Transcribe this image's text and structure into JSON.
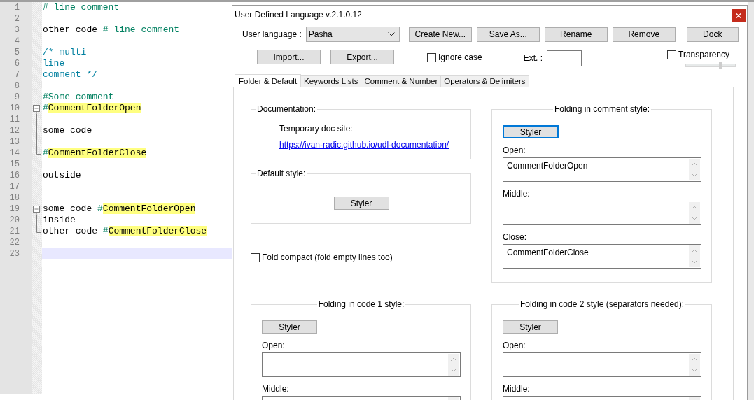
{
  "editor": {
    "lines": [
      {
        "number": "1",
        "kind": "plain",
        "segments": [
          {
            "text": "# line comment",
            "kind": "comment"
          }
        ]
      },
      {
        "number": "2",
        "kind": "plain"
      },
      {
        "number": "3",
        "kind": "plain",
        "segments": [
          {
            "text": "other code ",
            "kind": "code"
          },
          {
            "text": "# line comment",
            "kind": "comment"
          }
        ]
      },
      {
        "number": "4",
        "kind": "plain"
      },
      {
        "number": "5",
        "kind": "plain",
        "segments": [
          {
            "text": "/* multi",
            "kind": "block"
          }
        ]
      },
      {
        "number": "6",
        "kind": "plain",
        "segments": [
          {
            "text": "line",
            "kind": "block"
          }
        ]
      },
      {
        "number": "7",
        "kind": "plain",
        "segments": [
          {
            "text": "comment */",
            "kind": "block"
          }
        ]
      },
      {
        "number": "8",
        "kind": "plain"
      },
      {
        "number": "9",
        "kind": "plain",
        "segments": [
          {
            "text": "#Some comment",
            "kind": "comment"
          }
        ]
      },
      {
        "number": "10",
        "kind": "fold_open",
        "segments": [
          {
            "text": "#",
            "kind": "comment"
          },
          {
            "text": "CommentFolderOpen",
            "kind": "keyword"
          }
        ]
      },
      {
        "number": "11",
        "kind": "fold_middle"
      },
      {
        "number": "12",
        "kind": "fold_middle",
        "segments": [
          {
            "text": "some code",
            "kind": "code"
          }
        ]
      },
      {
        "number": "13",
        "kind": "fold_middle"
      },
      {
        "number": "14",
        "kind": "fold_end",
        "segments": [
          {
            "text": "#",
            "kind": "comment"
          },
          {
            "text": "CommentFolderClose",
            "kind": "keyword"
          }
        ]
      },
      {
        "number": "15",
        "kind": "plain"
      },
      {
        "number": "16",
        "kind": "plain",
        "segments": [
          {
            "text": "outside",
            "kind": "code"
          }
        ]
      },
      {
        "number": "17",
        "kind": "plain"
      },
      {
        "number": "18",
        "kind": "plain"
      },
      {
        "number": "19",
        "kind": "fold_open",
        "segments": [
          {
            "text": "some code ",
            "kind": "code"
          },
          {
            "text": "#",
            "kind": "comment"
          },
          {
            "text": "CommentFolderOpen",
            "kind": "keyword"
          }
        ]
      },
      {
        "number": "20",
        "kind": "fold_middle",
        "segments": [
          {
            "text": "inside",
            "kind": "code"
          }
        ]
      },
      {
        "number": "21",
        "kind": "fold_end",
        "segments": [
          {
            "text": "other code ",
            "kind": "code"
          },
          {
            "text": "#",
            "kind": "comment"
          },
          {
            "text": "CommentFolderClose",
            "kind": "keyword"
          }
        ]
      },
      {
        "number": "22",
        "kind": "plain"
      },
      {
        "number": "23",
        "kind": "plain",
        "current": true
      }
    ]
  },
  "dialog": {
    "title": "User Defined Language v.2.1.0.12",
    "language_label": "User language :",
    "language_value": "Pasha",
    "top_buttons": [
      "Create New...",
      "Save As...",
      "Rename",
      "Remove"
    ],
    "dock_button": "Dock",
    "io_buttons": [
      "Import...",
      "Export..."
    ],
    "ignore_case": {
      "label": "Ignore case",
      "checked": false
    },
    "ext_label": "Ext. :",
    "transparency": {
      "label": "Transparency",
      "checked": false,
      "level": 0.7
    },
    "tabs": [
      {
        "label": "Folder & Default",
        "selected": true
      },
      {
        "label": "Keywords Lists",
        "selected": false
      },
      {
        "label": "Comment & Number",
        "selected": false
      },
      {
        "label": "Operators & Delimiters",
        "selected": false
      }
    ],
    "documentation": {
      "title": "Documentation:",
      "text": "Temporary doc site:",
      "link": "https://ivan-radic.github.io/udl-documentation/"
    },
    "default_style": {
      "title": "Default style:",
      "button": {
        "label": "Styler",
        "focused": false
      }
    },
    "fold_compact": {
      "label": "Fold compact (fold empty lines too)",
      "checked": false
    },
    "comment_folding": {
      "title": "Folding in comment style:",
      "button": {
        "label": "Styler",
        "focused": true
      },
      "fields": [
        {
          "label": "Open:",
          "value": "CommentFolderOpen"
        },
        {
          "label": "Middle:"
        },
        {
          "label": "Close:",
          "value": "CommentFolderClose"
        }
      ]
    },
    "code_folding": [
      {
        "title": "Folding in code 1 style:",
        "button": {
          "label": "Styler",
          "focused": false
        },
        "fields": [
          {
            "label": "Open:"
          },
          {
            "label": "Middle:"
          }
        ]
      },
      {
        "title": "Folding in code 2 style (separators needed):",
        "button": {
          "label": "Styler",
          "focused": false
        },
        "fields": [
          {
            "label": "Open:"
          },
          {
            "label": "Middle:"
          }
        ]
      }
    ]
  }
}
